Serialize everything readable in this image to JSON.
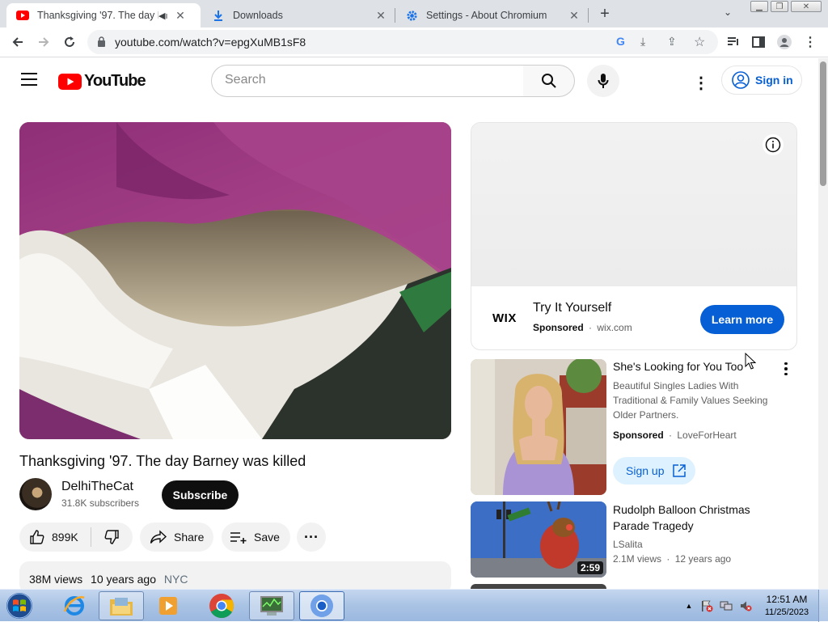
{
  "browser": {
    "tabs": [
      {
        "title": "Thanksgiving '97. The day Barney",
        "active": true
      },
      {
        "title": "Downloads",
        "active": false
      },
      {
        "title": "Settings - About Chromium",
        "active": false
      }
    ],
    "url": "youtube.com/watch?v=epgXuMB1sF8"
  },
  "youtube": {
    "logo_text": "YouTube",
    "search_placeholder": "Search",
    "sign_in": "Sign in",
    "video": {
      "title": "Thanksgiving '97. The day Barney was killed",
      "channel": "DelhiTheCat",
      "subscribers": "31.8K subscribers",
      "subscribe_label": "Subscribe",
      "likes": "899K",
      "share_label": "Share",
      "save_label": "Save",
      "views": "38M views",
      "age": "10 years ago",
      "tag": "NYC"
    },
    "ad": {
      "brand": "WIX",
      "title": "Try It Yourself",
      "sponsored": "Sponsored",
      "domain": "wix.com",
      "cta": "Learn more"
    },
    "sponsored_card": {
      "title": "She's Looking for You Too",
      "description": "Beautiful Singles Ladies With Traditional & Family Values Seeking Older Partners.",
      "sponsored": "Sponsored",
      "advertiser": "LoveForHeart",
      "cta": "Sign up"
    },
    "recommended": [
      {
        "title": "Rudolph Balloon Christmas Parade Tragedy",
        "channel": "LSalita",
        "views": "2.1M views",
        "age": "12 years ago",
        "duration": "2:59"
      }
    ]
  },
  "taskbar": {
    "time": "12:51 AM",
    "date": "11/25/2023"
  },
  "colors": {
    "youtube_red": "#ff0000",
    "link_blue": "#065fd4",
    "tab_strip": "#dee1e6"
  }
}
